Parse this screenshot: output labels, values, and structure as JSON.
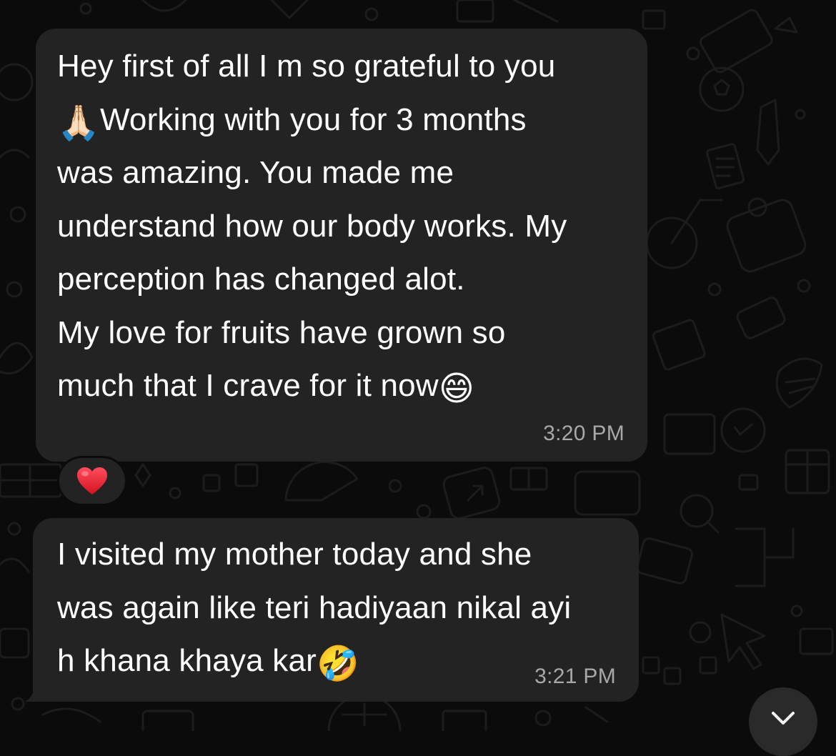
{
  "messages": [
    {
      "lines": [
        "Hey first of all I m so grateful to you",
        "Working with you for 3 months",
        "was amazing. You made me",
        "understand how our body works. My",
        "perception has changed alot.",
        "My love for fruits have grown so",
        "much that I crave for it now"
      ],
      "emoji_prefix_line2": "🙏🏻",
      "emoji_suffix_line7": "😄",
      "time": "3:20 PM",
      "reaction": "❤️"
    },
    {
      "lines": [
        "I visited my mother today and she",
        "was again like teri hadiyaan nikal ayi",
        "h khana khaya kar"
      ],
      "emoji_suffix_line3": "🤣",
      "time": "3:21 PM"
    }
  ],
  "icons": {
    "reaction_icon": "heart-icon",
    "scroll_down_icon": "chevron-down-icon"
  },
  "colors": {
    "bubble": "#232323",
    "background": "#0b0b0b",
    "timestamp": "#a8a8a8",
    "heart": "#e0202e"
  }
}
